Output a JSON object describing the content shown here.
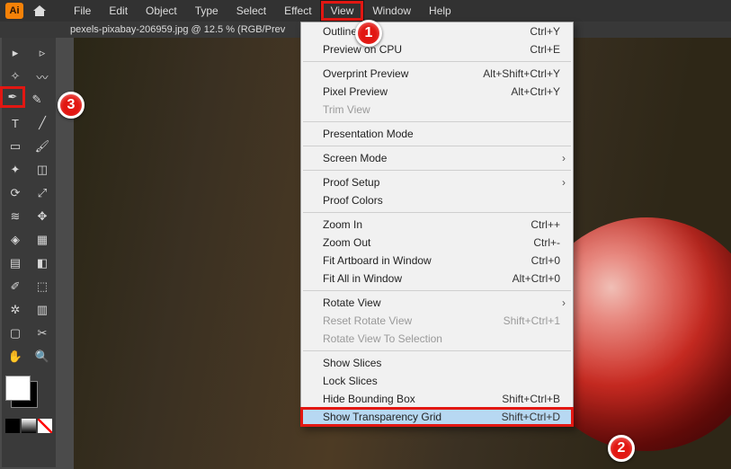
{
  "app": {
    "badge": "Ai"
  },
  "menubar": {
    "items": [
      "File",
      "Edit",
      "Object",
      "Type",
      "Select",
      "Effect",
      "View",
      "Window",
      "Help"
    ]
  },
  "tab": {
    "title": "pexels-pixabay-206959.jpg @ 12.5 % (RGB/Prev"
  },
  "callouts": {
    "c1": "1",
    "c2": "2",
    "c3": "3"
  },
  "viewMenu": [
    {
      "label": "Outline",
      "shortcut": "Ctrl+Y",
      "disabled": false
    },
    {
      "label": "Preview on CPU",
      "shortcut": "Ctrl+E",
      "disabled": false
    },
    {
      "sep": true
    },
    {
      "label": "Overprint Preview",
      "shortcut": "Alt+Shift+Ctrl+Y",
      "disabled": false
    },
    {
      "label": "Pixel Preview",
      "shortcut": "Alt+Ctrl+Y",
      "disabled": false
    },
    {
      "label": "Trim View",
      "shortcut": "",
      "disabled": true
    },
    {
      "sep": true
    },
    {
      "label": "Presentation Mode",
      "shortcut": "",
      "disabled": false
    },
    {
      "sep": true
    },
    {
      "label": "Screen Mode",
      "shortcut": "",
      "disabled": false,
      "submenu": true
    },
    {
      "sep": true
    },
    {
      "label": "Proof Setup",
      "shortcut": "",
      "disabled": false,
      "submenu": true
    },
    {
      "label": "Proof Colors",
      "shortcut": "",
      "disabled": false
    },
    {
      "sep": true
    },
    {
      "label": "Zoom In",
      "shortcut": "Ctrl++",
      "disabled": false
    },
    {
      "label": "Zoom Out",
      "shortcut": "Ctrl+-",
      "disabled": false
    },
    {
      "label": "Fit Artboard in Window",
      "shortcut": "Ctrl+0",
      "disabled": false
    },
    {
      "label": "Fit All in Window",
      "shortcut": "Alt+Ctrl+0",
      "disabled": false
    },
    {
      "sep": true
    },
    {
      "label": "Rotate View",
      "shortcut": "",
      "disabled": false,
      "submenu": true
    },
    {
      "label": "Reset Rotate View",
      "shortcut": "Shift+Ctrl+1",
      "disabled": true
    },
    {
      "label": "Rotate View To Selection",
      "shortcut": "",
      "disabled": true
    },
    {
      "sep": true
    },
    {
      "label": "Show Slices",
      "shortcut": "",
      "disabled": false
    },
    {
      "label": "Lock Slices",
      "shortcut": "",
      "disabled": false
    },
    {
      "label": "Hide Bounding Box",
      "shortcut": "Shift+Ctrl+B",
      "disabled": false
    },
    {
      "label": "Show Transparency Grid",
      "shortcut": "Shift+Ctrl+D",
      "disabled": false,
      "highlight": true
    }
  ],
  "tools": {
    "rows": [
      [
        "selection",
        "direct-selection"
      ],
      [
        "magic-wand",
        "lasso"
      ],
      [
        "pen",
        "curvature"
      ],
      [
        "type",
        "line"
      ],
      [
        "rectangle",
        "paintbrush"
      ],
      [
        "shaper",
        "eraser"
      ],
      [
        "rotate",
        "scale"
      ],
      [
        "width",
        "free-transform"
      ],
      [
        "shape-builder",
        "perspective"
      ],
      [
        "mesh",
        "gradient"
      ],
      [
        "eyedropper",
        "blend"
      ],
      [
        "symbol-sprayer",
        "graph"
      ],
      [
        "artboard",
        "slice"
      ],
      [
        "hand",
        "zoom"
      ]
    ]
  }
}
